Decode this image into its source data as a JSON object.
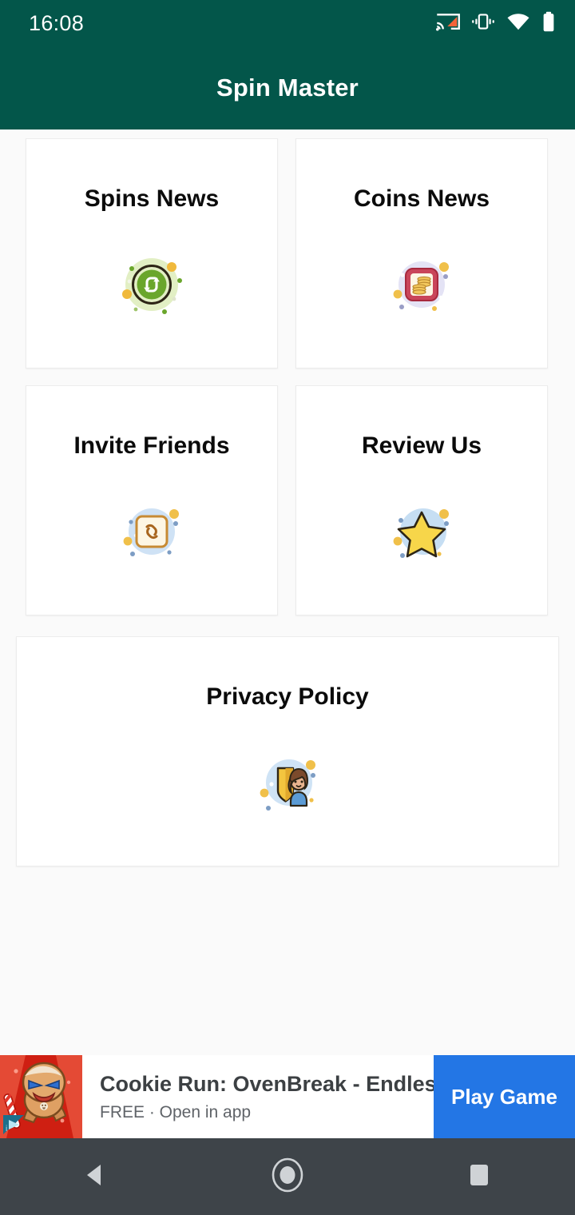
{
  "status_bar": {
    "clock": "16:08",
    "icons": [
      {
        "name": "cast-icon",
        "label": "cast"
      },
      {
        "name": "vibrate-icon",
        "label": "vibrate"
      },
      {
        "name": "wifi-icon",
        "label": "wifi"
      },
      {
        "name": "battery-icon",
        "label": "battery"
      }
    ]
  },
  "app_bar": {
    "title": "Spin Master",
    "background_color": "#03564a",
    "title_color": "#ffffff"
  },
  "cards": [
    {
      "id": "spins-news",
      "title": "Spins News",
      "icon": "spin-refresh-icon",
      "icon_circle_color": "#e2efc4",
      "icon_accent_color": "#6aa62c"
    },
    {
      "id": "coins-news",
      "title": "Coins News",
      "icon": "coin-stack-icon",
      "icon_circle_color": "#e4e3f5",
      "icon_accent_color": "#c9455a"
    },
    {
      "id": "invite-friends",
      "title": "Invite Friends",
      "icon": "chain-link-icon",
      "icon_circle_color": "#cfe2f5",
      "icon_accent_color": "#c78a33"
    },
    {
      "id": "review-us",
      "title": "Review Us",
      "icon": "star-icon",
      "icon_circle_color": "#c6def3",
      "icon_accent_color": "#f7d64a"
    },
    {
      "id": "privacy-policy",
      "title": "Privacy Policy",
      "icon": "shield-woman-icon",
      "icon_circle_color": "#cfe3f5",
      "icon_accent_color": "#f3c53f"
    }
  ],
  "ad": {
    "headline": "Cookie Run: OvenBreak - Endles…",
    "subtitle": "FREE · Open in app",
    "cta_label": "Play Game",
    "cta_color": "#2376e5",
    "thumbnail_icon": "cookie-run-app-icon",
    "adchoices_icon": "adchoices-icon"
  },
  "nav_bar": {
    "background_color": "#3e4449",
    "buttons": [
      {
        "name": "back-button",
        "icon": "triangle-back-icon"
      },
      {
        "name": "home-button",
        "icon": "circle-home-icon"
      },
      {
        "name": "recents-button",
        "icon": "square-recents-icon"
      }
    ]
  },
  "page": {
    "background_color": "#fafafa",
    "card_background_color": "#ffffff",
    "card_title_color": "#0b0b0b"
  }
}
